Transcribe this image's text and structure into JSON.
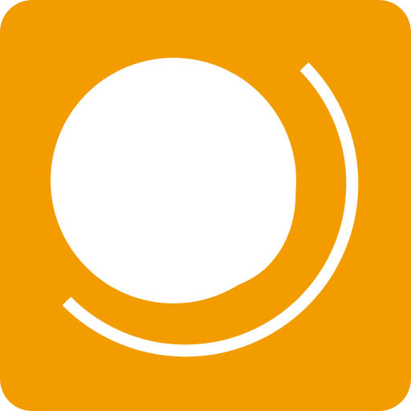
{
  "icon": {
    "name": "orange-app-icon",
    "description_colors": {
      "background": "#F39C00",
      "foreground": "#FFFFFF"
    }
  }
}
